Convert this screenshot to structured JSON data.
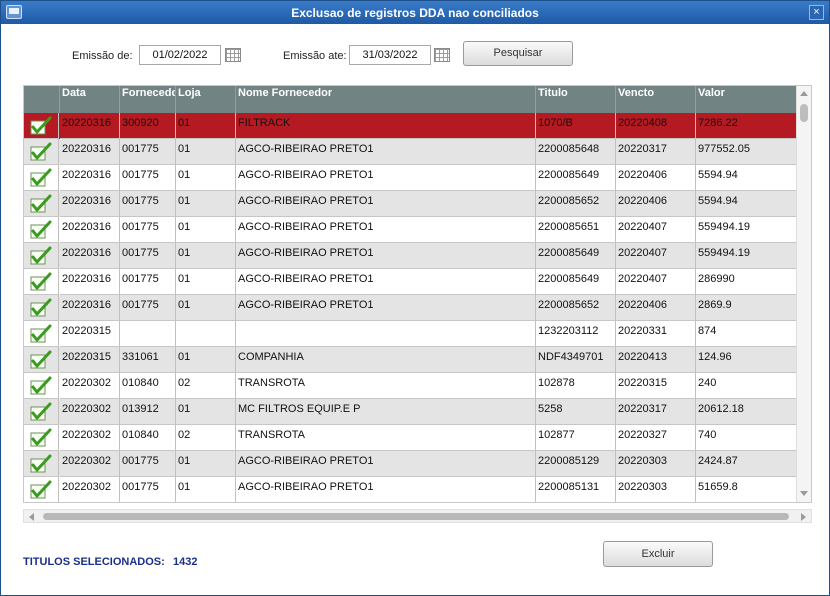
{
  "window": {
    "title": "Exclusao de registros DDA nao conciliados",
    "close_glyph": "×"
  },
  "filters": {
    "emissao_de_label": "Emissão de:",
    "emissao_de_value": "01/02/2022",
    "emissao_ate_label": "Emissão ate:",
    "emissao_ate_value": "31/03/2022",
    "search_button": "Pesquisar"
  },
  "table": {
    "columns": [
      "Data",
      "Fornecedor",
      "Loja",
      "Nome Fornecedor",
      "Titulo",
      "Vencto",
      "Valor"
    ],
    "selected_row_color": "#b51a22",
    "header_color": "#728383",
    "rows": [
      {
        "data": "20220316",
        "fornecedor": "300920",
        "loja": "01",
        "nome": "FILTRACK",
        "titulo": "1070/B",
        "vencto": "20220408",
        "valor": "7286.22",
        "checked": true
      },
      {
        "data": "20220316",
        "fornecedor": "001775",
        "loja": "01",
        "nome": "AGCO-RIBEIRAO PRETO1",
        "titulo": "2200085648",
        "vencto": "20220317",
        "valor": "977552.05",
        "checked": true
      },
      {
        "data": "20220316",
        "fornecedor": "001775",
        "loja": "01",
        "nome": "AGCO-RIBEIRAO PRETO1",
        "titulo": "2200085649",
        "vencto": "20220406",
        "valor": "5594.94",
        "checked": true
      },
      {
        "data": "20220316",
        "fornecedor": "001775",
        "loja": "01",
        "nome": "AGCO-RIBEIRAO PRETO1",
        "titulo": "2200085652",
        "vencto": "20220406",
        "valor": "5594.94",
        "checked": true
      },
      {
        "data": "20220316",
        "fornecedor": "001775",
        "loja": "01",
        "nome": "AGCO-RIBEIRAO PRETO1",
        "titulo": "2200085651",
        "vencto": "20220407",
        "valor": "559494.19",
        "checked": true
      },
      {
        "data": "20220316",
        "fornecedor": "001775",
        "loja": "01",
        "nome": "AGCO-RIBEIRAO PRETO1",
        "titulo": "2200085649",
        "vencto": "20220407",
        "valor": "559494.19",
        "checked": true
      },
      {
        "data": "20220316",
        "fornecedor": "001775",
        "loja": "01",
        "nome": "AGCO-RIBEIRAO PRETO1",
        "titulo": "2200085649",
        "vencto": "20220407",
        "valor": "286990",
        "checked": true
      },
      {
        "data": "20220316",
        "fornecedor": "001775",
        "loja": "01",
        "nome": "AGCO-RIBEIRAO PRETO1",
        "titulo": "2200085652",
        "vencto": "20220406",
        "valor": "2869.9",
        "checked": true
      },
      {
        "data": "20220315",
        "fornecedor": "",
        "loja": "",
        "nome": "",
        "titulo": "1232203112",
        "vencto": "20220331",
        "valor": "874",
        "checked": true
      },
      {
        "data": "20220315",
        "fornecedor": "331061",
        "loja": "01",
        "nome": "COMPANHIA",
        "titulo": "NDF4349701",
        "vencto": "20220413",
        "valor": "124.96",
        "checked": true
      },
      {
        "data": "20220302",
        "fornecedor": "010840",
        "loja": "02",
        "nome": "TRANSROTA",
        "titulo": "102878",
        "vencto": "20220315",
        "valor": "240",
        "checked": true
      },
      {
        "data": "20220302",
        "fornecedor": "013912",
        "loja": "01",
        "nome": "MC FILTROS EQUIP.E P",
        "titulo": "5258",
        "vencto": "20220317",
        "valor": "20612.18",
        "checked": true
      },
      {
        "data": "20220302",
        "fornecedor": "010840",
        "loja": "02",
        "nome": "TRANSROTA",
        "titulo": "102877",
        "vencto": "20220327",
        "valor": "740",
        "checked": true
      },
      {
        "data": "20220302",
        "fornecedor": "001775",
        "loja": "01",
        "nome": "AGCO-RIBEIRAO PRETO1",
        "titulo": "2200085129",
        "vencto": "20220303",
        "valor": "2424.87",
        "checked": true
      },
      {
        "data": "20220302",
        "fornecedor": "001775",
        "loja": "01",
        "nome": "AGCO-RIBEIRAO PRETO1",
        "titulo": "2200085131",
        "vencto": "20220303",
        "valor": "51659.8",
        "checked": true
      }
    ]
  },
  "footer": {
    "selected_label": "TITULOS SELECIONADOS:",
    "selected_count": "1432",
    "delete_button": "Excluir"
  },
  "icons": {
    "checkbox": "green-check-icon",
    "calendar": "calendar-icon",
    "close": "close-icon"
  }
}
